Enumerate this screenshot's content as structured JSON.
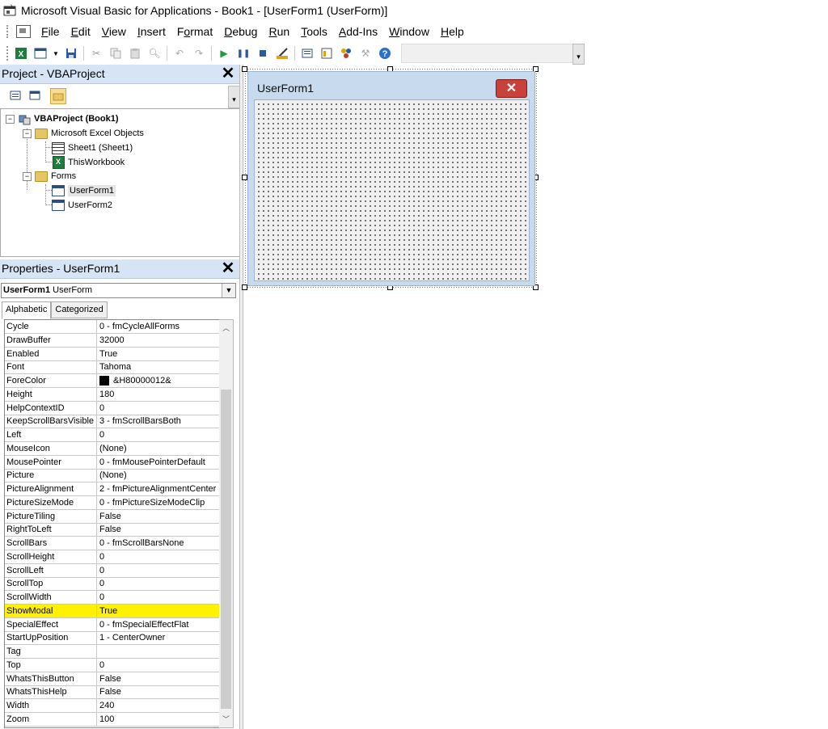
{
  "window": {
    "title": "Microsoft Visual Basic for Applications - Book1 - [UserForm1 (UserForm)]"
  },
  "menu": [
    {
      "acc": "F",
      "rest": "ile"
    },
    {
      "acc": "E",
      "rest": "dit"
    },
    {
      "acc": "V",
      "rest": "iew"
    },
    {
      "acc": "I",
      "rest": "nsert"
    },
    {
      "pre": "F",
      "acc": "o",
      "rest": "rmat"
    },
    {
      "acc": "D",
      "rest": "ebug"
    },
    {
      "acc": "R",
      "rest": "un"
    },
    {
      "acc": "T",
      "rest": "ools"
    },
    {
      "acc": "A",
      "rest": "dd-Ins"
    },
    {
      "acc": "W",
      "rest": "indow"
    },
    {
      "acc": "H",
      "rest": "elp"
    }
  ],
  "project": {
    "title": "Project - VBAProject",
    "close": "✕",
    "tree": {
      "root": "VBAProject (Book1)",
      "excel_objects": "Microsoft Excel Objects",
      "sheet1": "Sheet1 (Sheet1)",
      "thisworkbook": "ThisWorkbook",
      "forms": "Forms",
      "userform1": "UserForm1",
      "userform2": "UserForm2"
    }
  },
  "properties": {
    "title": "Properties - UserForm1",
    "close": "✕",
    "object_name": "UserForm1",
    "object_type": "UserForm",
    "tabs": [
      "Alphabetic",
      "Categorized"
    ],
    "rows": [
      {
        "name": "Cycle",
        "value": "0 - fmCycleAllForms"
      },
      {
        "name": "DrawBuffer",
        "value": "32000"
      },
      {
        "name": "Enabled",
        "value": "True"
      },
      {
        "name": "Font",
        "value": "Tahoma"
      },
      {
        "name": "ForeColor",
        "value": "&H80000012&",
        "swatch": "#000000"
      },
      {
        "name": "Height",
        "value": "180"
      },
      {
        "name": "HelpContextID",
        "value": "0"
      },
      {
        "name": "KeepScrollBarsVisible",
        "value": "3 - fmScrollBarsBoth"
      },
      {
        "name": "Left",
        "value": "0"
      },
      {
        "name": "MouseIcon",
        "value": "(None)"
      },
      {
        "name": "MousePointer",
        "value": "0 - fmMousePointerDefault"
      },
      {
        "name": "Picture",
        "value": "(None)"
      },
      {
        "name": "PictureAlignment",
        "value": "2 - fmPictureAlignmentCenter"
      },
      {
        "name": "PictureSizeMode",
        "value": "0 - fmPictureSizeModeClip"
      },
      {
        "name": "PictureTiling",
        "value": "False"
      },
      {
        "name": "RightToLeft",
        "value": "False"
      },
      {
        "name": "ScrollBars",
        "value": "0 - fmScrollBarsNone"
      },
      {
        "name": "ScrollHeight",
        "value": "0"
      },
      {
        "name": "ScrollLeft",
        "value": "0"
      },
      {
        "name": "ScrollTop",
        "value": "0"
      },
      {
        "name": "ScrollWidth",
        "value": "0"
      },
      {
        "name": "ShowModal",
        "value": "True",
        "highlight": "#fff200"
      },
      {
        "name": "SpecialEffect",
        "value": "0 - fmSpecialEffectFlat"
      },
      {
        "name": "StartUpPosition",
        "value": "1 - CenterOwner"
      },
      {
        "name": "Tag",
        "value": ""
      },
      {
        "name": "Top",
        "value": "0"
      },
      {
        "name": "WhatsThisButton",
        "value": "False"
      },
      {
        "name": "WhatsThisHelp",
        "value": "False"
      },
      {
        "name": "Width",
        "value": "240"
      },
      {
        "name": "Zoom",
        "value": "100"
      }
    ]
  },
  "designer": {
    "form_caption": "UserForm1",
    "close_glyph": "✕"
  },
  "colors": {
    "pane_header": "#d6e4f5",
    "form_frame": "#c8daed",
    "form_close": "#c9413b",
    "highlight": "#fff200"
  }
}
